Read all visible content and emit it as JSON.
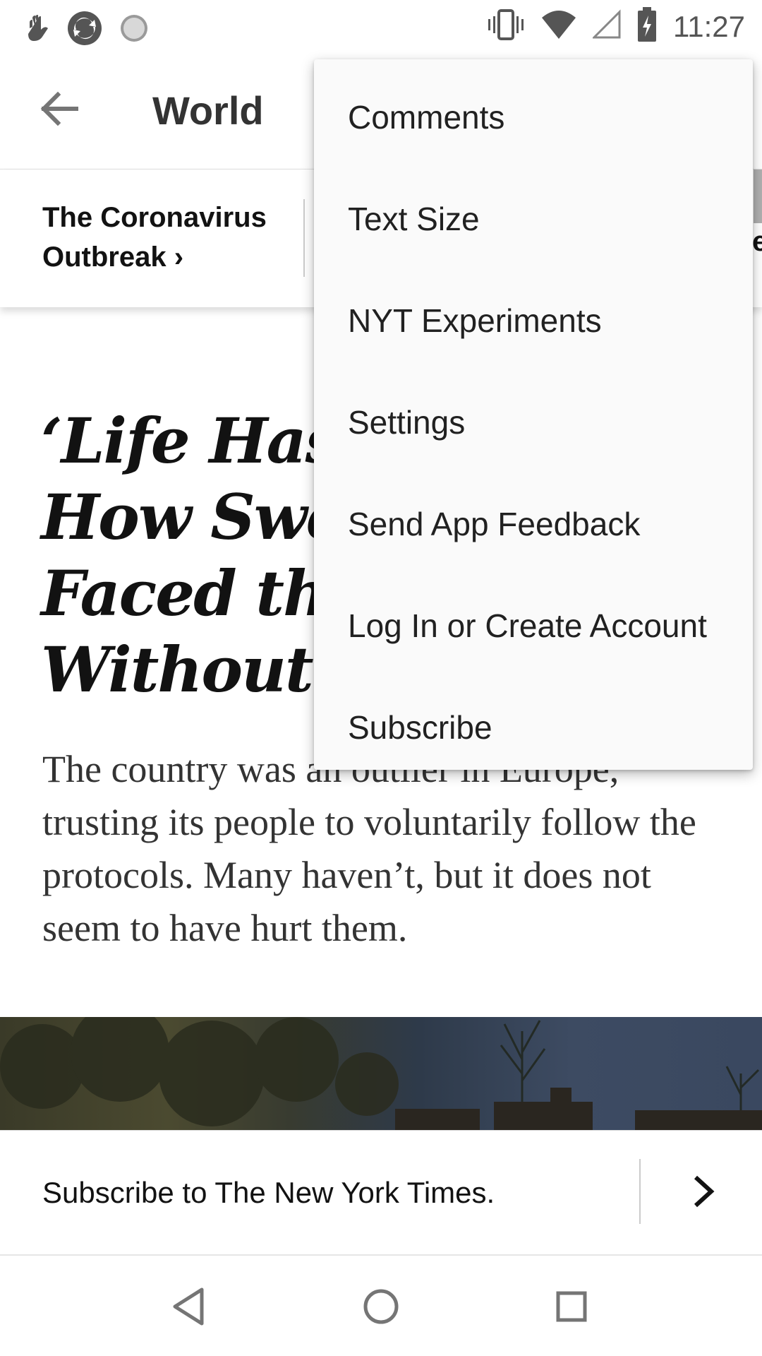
{
  "status_bar": {
    "time": "11:27",
    "left_icons": [
      "hand-icon",
      "sync-icon",
      "loading-icon"
    ],
    "right_icons": [
      "vibrate-icon",
      "wifi-icon",
      "signal-icon",
      "battery-charging-icon"
    ]
  },
  "app_bar": {
    "title": "World",
    "back_icon": "arrow-left-icon"
  },
  "section_strip": {
    "link_label": "The Coronavirus Outbreak ›",
    "peek_text": "e"
  },
  "article": {
    "headline": "‘Life Has to Go On’: How Sweden Has Faced the Virus Without a Lockdown",
    "summary": "The country was an outlier in Europe, trusting its people to voluntarily follow the protocols. Many haven’t, but it does not seem to have hurt them."
  },
  "subscribe_banner": {
    "text": "Subscribe to The New York Times.",
    "arrow_icon": "chevron-right-icon"
  },
  "overflow_menu": {
    "items": [
      "Comments",
      "Text Size",
      "NYT Experiments",
      "Settings",
      "Send App Feedback",
      "Log In or Create Account",
      "Subscribe"
    ]
  },
  "nav_bar": {
    "icons": [
      "back-triangle-icon",
      "home-circle-icon",
      "recents-square-icon"
    ]
  },
  "colors": {
    "menu_background": "#fafafa",
    "text_primary": "#121212",
    "icon_gray": "#757575"
  }
}
